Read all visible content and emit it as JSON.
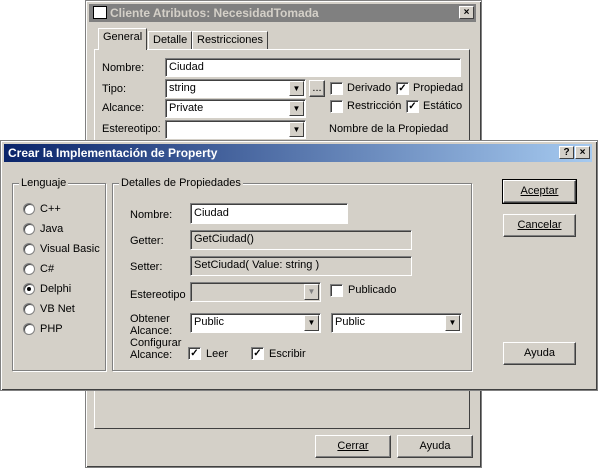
{
  "back_window": {
    "title": "Cliente Atributos: NecesidadTomada",
    "tabs": [
      "General",
      "Detalle",
      "Restricciones"
    ],
    "nombre_label": "Nombre:",
    "nombre_value": "Ciudad",
    "tipo_label": "Tipo:",
    "tipo_value": "string",
    "browse_label": "...",
    "alcance_label": "Alcance:",
    "alcance_value": "Private",
    "estereotipo_label": "Estereotipo:",
    "estereotipo_value": "",
    "derivado_label": "Derivado",
    "derivado_checked": false,
    "propiedad_label": "Propiedad",
    "propiedad_checked": true,
    "restriccion_label": "Restricción",
    "restriccion_checked": false,
    "estatico_label": "Estático",
    "estatico_checked": true,
    "nombre_propiedad_label": "Nombre de la Propiedad",
    "cerrar_label": "Cerrar",
    "ayuda_label": "Ayuda"
  },
  "dialog": {
    "title": "Crear la Implementación de Property",
    "help_glyph": "?",
    "close_glyph": "×",
    "lenguaje": {
      "title": "Lenguaje",
      "options": [
        "C++",
        "Java",
        "Visual Basic",
        "C#",
        "Delphi",
        "VB Net",
        "PHP"
      ],
      "selected": "Delphi"
    },
    "detalles": {
      "title": "Detalles de Propiedades",
      "nombre_label": "Nombre:",
      "nombre_value": "Ciudad",
      "getter_label": "Getter:",
      "getter_value": "GetCiudad()",
      "setter_label": "Setter:",
      "setter_value": "SetCiudad( Value: string )",
      "estereotipo_label": "Estereotipo",
      "estereotipo_value": "",
      "publicado_label": "Publicado",
      "publicado_checked": false,
      "obtener_label": "Obtener",
      "alcance_label": "Alcance:",
      "obtener_alcance_value": "Public",
      "configurar_label": "Configurar",
      "configurar_alcance_label": "Alcance:",
      "configurar_alcance_value": "Public",
      "leer_label": "Leer",
      "leer_checked": true,
      "escribir_label": "Escribir",
      "escribir_checked": true
    },
    "aceptar_label": "Aceptar",
    "cancelar_label": "Cancelar",
    "ayuda_label": "Ayuda"
  },
  "glyphs": {
    "check": "✓",
    "dropdown": "▼"
  },
  "colors": {
    "face": "#d4d0c8",
    "active_title_start": "#0a246a",
    "active_title_end": "#a6caf0",
    "inactive_title": "#808080"
  }
}
